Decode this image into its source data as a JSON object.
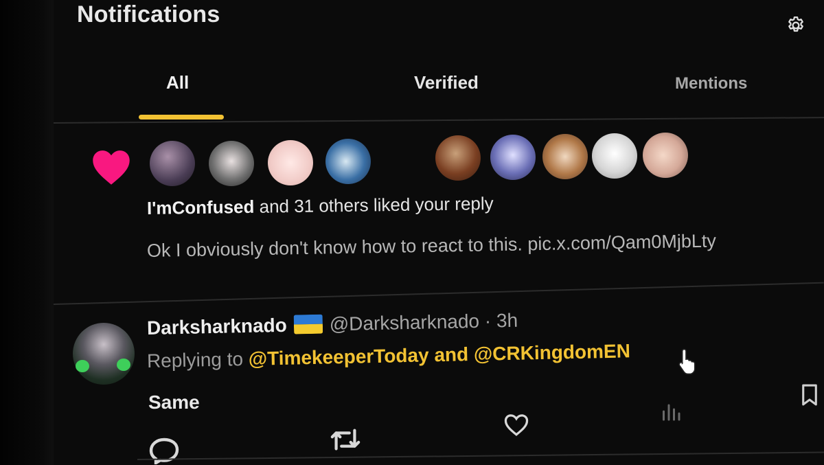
{
  "header": {
    "title": "Notifications",
    "settings_icon": "gear-icon"
  },
  "tabs": [
    {
      "label": "All",
      "active": true
    },
    {
      "label": "Verified",
      "active": false
    },
    {
      "label": "Mentions",
      "active": false
    }
  ],
  "colors": {
    "accent": "#f2c233",
    "like": "#f91880",
    "background": "#0b0b0b"
  },
  "like_notification": {
    "icon": "heart-icon",
    "avatar_count": 9,
    "actor": "I'mConfused",
    "summary_rest": " and 31 others liked your reply",
    "reply_text": "Ok I obviously don't know how to react to this. pic.x.com/Qam0MjbLty"
  },
  "reply_notification": {
    "display_name": "Darksharknado",
    "flag": "ukraine-flag",
    "handle_time": "@Darksharknado · 3h",
    "replying_prefix": "Replying to ",
    "mention_1": "@TimekeeperToday",
    "mention_joiner": " and ",
    "mention_2": "@CRKingdomEN",
    "text": "Same",
    "actions": [
      "reply-icon",
      "retweet-icon",
      "like-icon",
      "stats-icon",
      "bookmark-icon"
    ]
  }
}
